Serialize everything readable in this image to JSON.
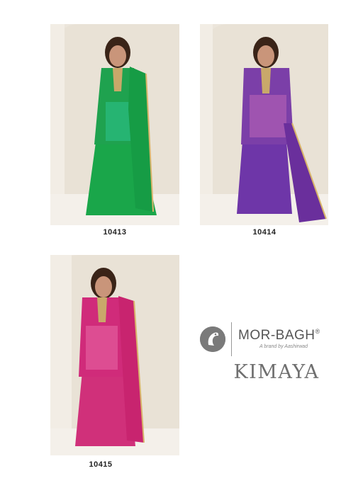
{
  "catalog": {
    "items": [
      {
        "code": "10413",
        "colors": {
          "kurta": "#1fa24f",
          "dupatta": "#169c45",
          "sharara": "#1aa64a"
        }
      },
      {
        "code": "10414",
        "colors": {
          "kurta": "#7b3fa8",
          "dupatta": "#6a2f9c",
          "sharara": "#6e36a8"
        }
      },
      {
        "code": "10415",
        "colors": {
          "kurta": "#d02b7a",
          "dupatta": "#c8246f",
          "sharara": "#d0307a"
        }
      }
    ]
  },
  "brand": {
    "name": "MOR-BAGH",
    "registered": "®",
    "tagline": "A brand by Aashirwad",
    "logo_icon": "peacock-icon"
  },
  "collection": {
    "name": "KIMAYA"
  }
}
